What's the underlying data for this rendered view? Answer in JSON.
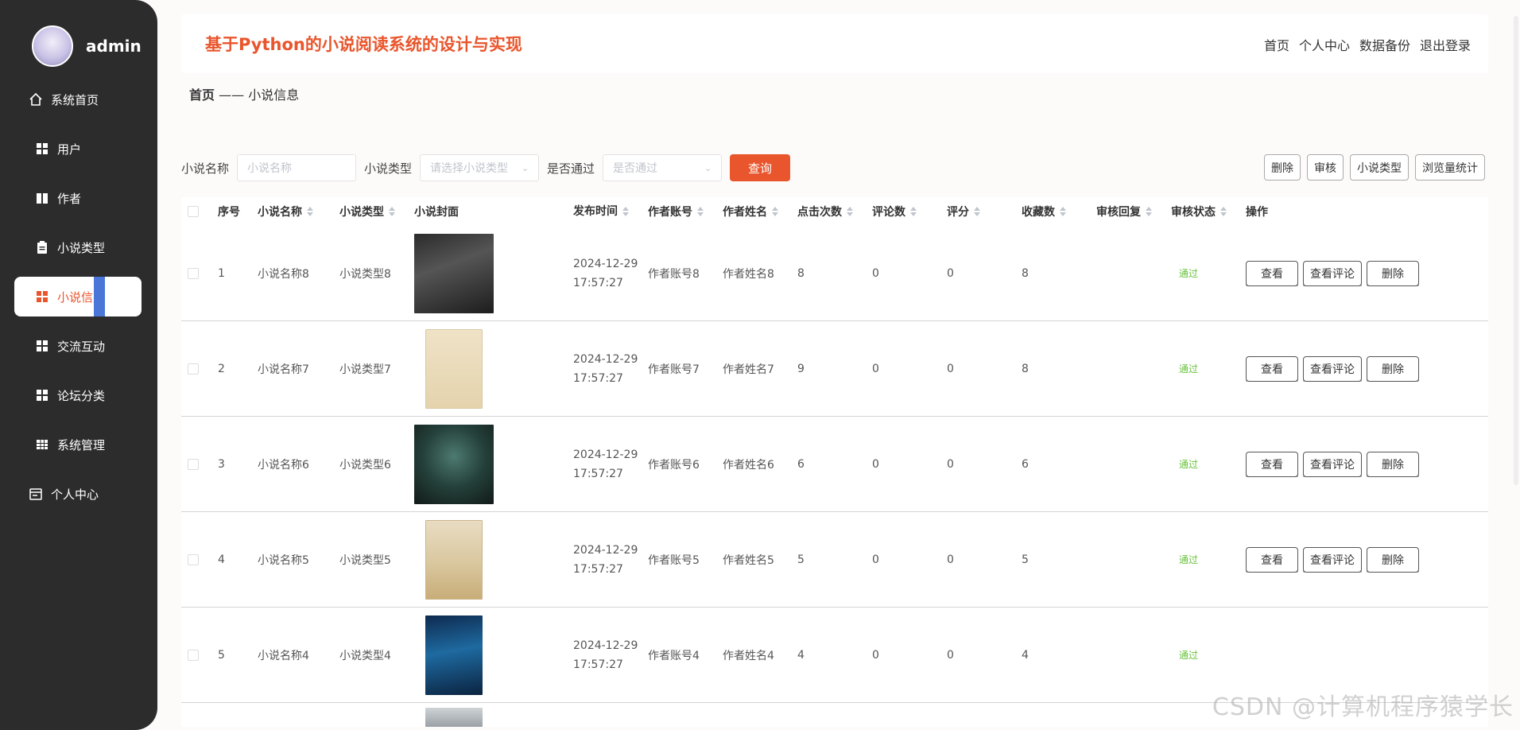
{
  "sidebar": {
    "username": "admin",
    "items": [
      {
        "label": "系统首页",
        "icon": "home-icon"
      },
      {
        "label": "用户",
        "icon": "grid-icon"
      },
      {
        "label": "作者",
        "icon": "book-icon"
      },
      {
        "label": "小说类型",
        "icon": "clipboard-icon"
      },
      {
        "label": "小说信息",
        "icon": "grid-icon",
        "active": true
      },
      {
        "label": "交流互动",
        "icon": "grid-icon"
      },
      {
        "label": "论坛分类",
        "icon": "grid-icon"
      },
      {
        "label": "系统管理",
        "icon": "table-icon"
      },
      {
        "label": "个人中心",
        "icon": "calendar-icon"
      }
    ]
  },
  "header": {
    "title": "基于Python的小说阅读系统的设计与实现",
    "nav": [
      "首页",
      "个人中心",
      "数据备份",
      "退出登录"
    ]
  },
  "breadcrumb": {
    "home": "首页",
    "sep": "——",
    "current": "小说信息"
  },
  "filters": {
    "name_label": "小说名称",
    "name_placeholder": "小说名称",
    "type_label": "小说类型",
    "type_placeholder": "请选择小说类型",
    "pass_label": "是否通过",
    "pass_placeholder": "是否通过",
    "query_button": "查询"
  },
  "actions": [
    "删除",
    "审核",
    "小说类型",
    "浏览量统计"
  ],
  "table": {
    "columns": [
      "序号",
      "小说名称",
      "小说类型",
      "小说封面",
      "发布时间",
      "作者账号",
      "作者姓名",
      "点击次数",
      "评论数",
      "评分",
      "收藏数",
      "审核回复",
      "审核状态",
      "操作"
    ],
    "row_buttons": [
      "查看",
      "查看评论",
      "删除"
    ],
    "rows": [
      {
        "idx": "1",
        "name": "小说名称8",
        "type": "小说类型8",
        "date": "2024-12-29",
        "time": "17:57:27",
        "account": "作者账号8",
        "author": "作者姓名8",
        "clicks": "8",
        "comments": "0",
        "score": "0",
        "fav": "8",
        "reply": "",
        "state": "通过"
      },
      {
        "idx": "2",
        "name": "小说名称7",
        "type": "小说类型7",
        "date": "2024-12-29",
        "time": "17:57:27",
        "account": "作者账号7",
        "author": "作者姓名7",
        "clicks": "9",
        "comments": "0",
        "score": "0",
        "fav": "8",
        "reply": "",
        "state": "通过"
      },
      {
        "idx": "3",
        "name": "小说名称6",
        "type": "小说类型6",
        "date": "2024-12-29",
        "time": "17:57:27",
        "account": "作者账号6",
        "author": "作者姓名6",
        "clicks": "6",
        "comments": "0",
        "score": "0",
        "fav": "6",
        "reply": "",
        "state": "通过"
      },
      {
        "idx": "4",
        "name": "小说名称5",
        "type": "小说类型5",
        "date": "2024-12-29",
        "time": "17:57:27",
        "account": "作者账号5",
        "author": "作者姓名5",
        "clicks": "5",
        "comments": "0",
        "score": "0",
        "fav": "5",
        "reply": "",
        "state": "通过"
      },
      {
        "idx": "5",
        "name": "小说名称4",
        "type": "小说类型4",
        "date": "2024-12-29",
        "time": "17:57:27",
        "account": "作者账号4",
        "author": "作者姓名4",
        "clicks": "4",
        "comments": "0",
        "score": "0",
        "fav": "4",
        "reply": "",
        "state": "通过"
      }
    ]
  },
  "watermark": "CSDN @计算机程序猿学长",
  "colors": {
    "accent": "#e9552c",
    "sidebar": "#2c2c2c",
    "pass": "#67c23a"
  }
}
